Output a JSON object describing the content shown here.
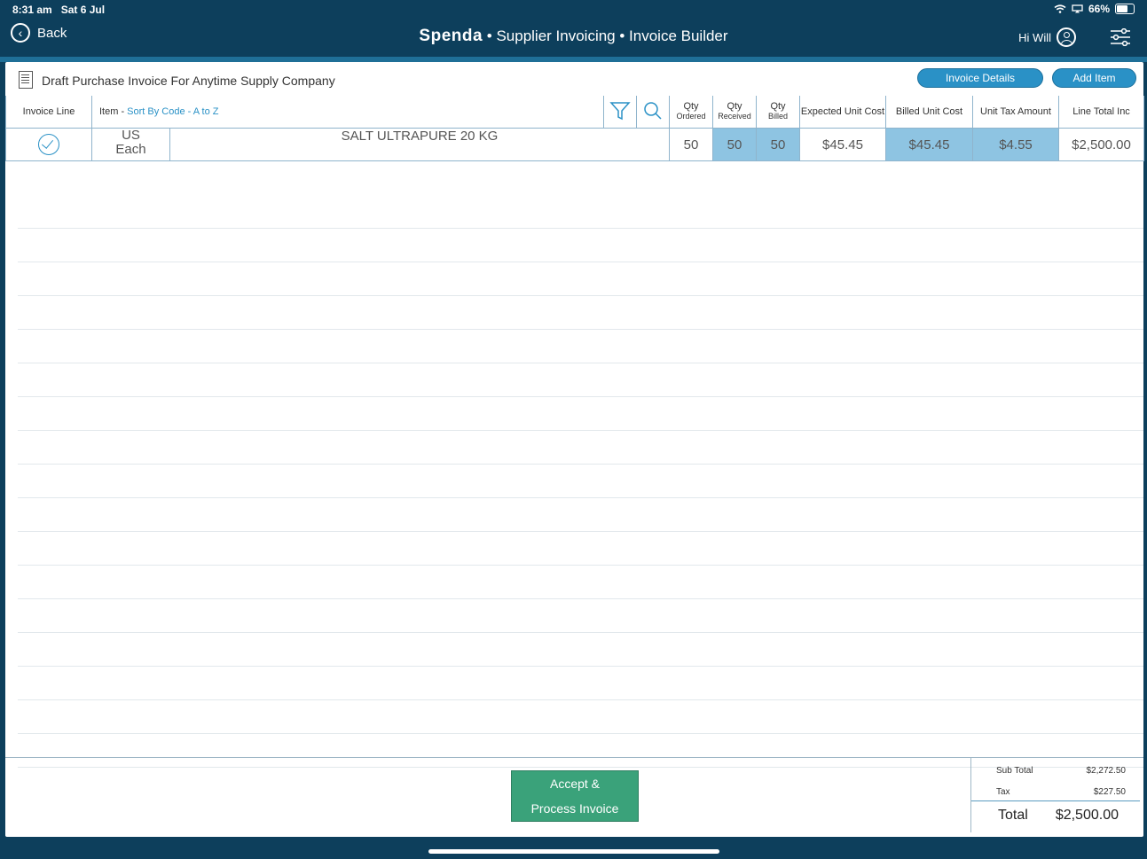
{
  "status_bar": {
    "time": "8:31 am",
    "date": "Sat 6 Jul",
    "battery": "66%"
  },
  "nav": {
    "back_label": "Back",
    "brand": "Spenda",
    "title_part1": " • Supplier Invoicing • ",
    "title_part2": "Invoice Builder",
    "greeting": "Hi Will"
  },
  "panel": {
    "title": "Draft Purchase Invoice For Anytime Supply Company",
    "invoice_details_label": "Invoice Details",
    "add_item_label": "Add Item"
  },
  "table": {
    "headers": {
      "invoice_line": "Invoice Line",
      "item": "Item - ",
      "sort": "Sort By Code - A to Z",
      "qty_ordered_1": "Qty",
      "qty_ordered_2": "Ordered",
      "qty_received_1": "Qty",
      "qty_received_2": "Received",
      "qty_billed_1": "Qty",
      "qty_billed_2": "Billed",
      "expected_unit_cost": "Expected Unit Cost",
      "billed_unit_cost": "Billed Unit Cost",
      "unit_tax_amount": "Unit Tax Amount",
      "line_total_inc": "Line Total Inc"
    },
    "rows": [
      {
        "code": "US",
        "uom": "Each",
        "description": "SALT ULTRAPURE 20 KG",
        "qty_ordered": "50",
        "qty_received": "50",
        "qty_billed": "50",
        "expected_unit_cost": "$45.45",
        "billed_unit_cost": "$45.45",
        "unit_tax_amount": "$4.55",
        "line_total_inc": "$2,500.00"
      }
    ]
  },
  "footer": {
    "accept_line1": "Accept &",
    "accept_line2": "Process Invoice",
    "subtotal_label": "Sub Total",
    "subtotal_value": "$2,272.50",
    "tax_label": "Tax",
    "tax_value": "$227.50",
    "total_label": "Total",
    "total_value": "$2,500.00"
  },
  "colors": {
    "nav_bg": "#0d3f5c",
    "accent": "#2a91c6",
    "accept_green": "#3aa27a",
    "cell_blue": "#8ec4e2"
  }
}
